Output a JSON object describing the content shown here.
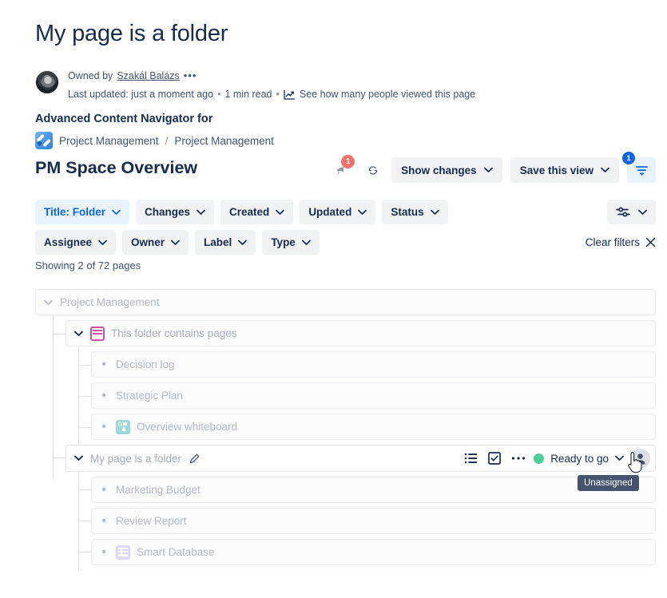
{
  "page": {
    "title": "My page is a folder",
    "byline": {
      "owned_by_prefix": "Owned by",
      "owner": "Szakál Balázs",
      "more_icon": "ellipsis-icon",
      "last_updated": "Last updated: just a moment ago",
      "read_time": "1 min read",
      "views_link": "See how many people viewed this page",
      "views_icon": "trend-chart-icon",
      "separator": "•"
    }
  },
  "macro": {
    "label": "Advanced Content Navigator for",
    "breadcrumb": {
      "space_icon": "space-rocket-icon",
      "space": "Project Management",
      "separator": "/",
      "page": "Project Management"
    },
    "title": "PM Space Overview",
    "actions": {
      "announce_icon": "megaphone-icon",
      "announce_badge": "1",
      "refresh_icon": "refresh-icon",
      "show_changes": "Show changes",
      "save_this_view": "Save this view",
      "filter_icon": "filter-icon",
      "filter_badge": "1"
    }
  },
  "filters": {
    "row1": [
      {
        "label": "Title: Folder",
        "active": true
      },
      {
        "label": "Changes",
        "active": false
      },
      {
        "label": "Created",
        "active": false
      },
      {
        "label": "Updated",
        "active": false
      },
      {
        "label": "Status",
        "active": false
      }
    ],
    "row2": [
      {
        "label": "Assignee",
        "active": false
      },
      {
        "label": "Owner",
        "active": false
      },
      {
        "label": "Label",
        "active": false
      },
      {
        "label": "Type",
        "active": false
      }
    ],
    "settings_icon": "sliders-icon",
    "clear_filters": "Clear filters",
    "clear_icon": "close-icon"
  },
  "results": {
    "showing": "Showing 2 of 72 pages"
  },
  "tree": {
    "rows": [
      {
        "label": "Project Management",
        "level": 0,
        "marker": "chevron-down",
        "icon": null,
        "state": "faded"
      },
      {
        "label": "This folder contains pages",
        "level": 1,
        "marker": "chevron-down",
        "icon": "folder-icon",
        "state": "faded"
      },
      {
        "label": "Decision log",
        "level": 2,
        "marker": "bullet",
        "icon": null,
        "state": "faded"
      },
      {
        "label": "Strategic Plan",
        "level": 2,
        "marker": "bullet",
        "icon": null,
        "state": "faded"
      },
      {
        "label": "Overview whiteboard",
        "level": 2,
        "marker": "bullet",
        "icon": "whiteboard-icon",
        "state": "faded"
      },
      {
        "label": "My page is a folder",
        "level": 1,
        "marker": "chevron-down",
        "icon": null,
        "state": "active"
      },
      {
        "label": "Marketing Budget",
        "level": 2,
        "marker": "bullet",
        "icon": null,
        "state": "faded"
      },
      {
        "label": "Review Report",
        "level": 2,
        "marker": "bullet",
        "icon": null,
        "state": "faded"
      },
      {
        "label": "Smart Database",
        "level": 2,
        "marker": "bullet",
        "icon": "database-icon",
        "state": "faded"
      }
    ],
    "active_row": {
      "edit_icon": "pencil-icon",
      "list_icon": "list-icon",
      "task_icon": "checkbox-checked-icon",
      "more_icon": "ellipsis-icon",
      "status_label": "Ready to go",
      "status_color": "#4BCE97",
      "status_chevron": "chevron-down-icon",
      "assignee_icon": "person-icon"
    }
  },
  "tooltip": {
    "text": "Unassigned"
  },
  "colors": {
    "accent_blue": "#0C66E4",
    "chip_bg": "#F1F2F4",
    "chip_active_bg": "#E9F2FF",
    "text": "#172B4D",
    "muted": "#B3B9C4",
    "folder_pink": "#CD519D",
    "status_green": "#4BCE97",
    "badge_red": "#F87168",
    "tooltip_bg": "#44546F"
  }
}
